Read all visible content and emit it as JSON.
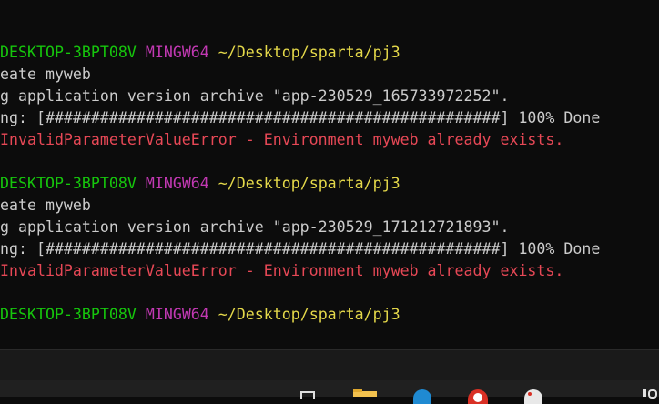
{
  "terminal": {
    "lines": [
      {
        "segments": [
          {
            "text": "DESKTOP-3BPT08V",
            "color": "#16c60c"
          },
          {
            "text": " ",
            "color": "#cccccc"
          },
          {
            "text": "MINGW64",
            "color": "#c239b3"
          },
          {
            "text": " ",
            "color": "#cccccc"
          },
          {
            "text": "~/Desktop/sparta/pj3",
            "color": "#e5d94a"
          }
        ]
      },
      {
        "segments": [
          {
            "text": "eate myweb",
            "color": "#cccccc"
          }
        ]
      },
      {
        "segments": [
          {
            "text": "g application version archive \"app-230529_165733972252\".",
            "color": "#cccccc"
          }
        ]
      },
      {
        "segments": [
          {
            "text": "ng: [##################################################] 100% Done",
            "color": "#cccccc"
          }
        ]
      },
      {
        "segments": [
          {
            "text": "InvalidParameterValueError - Environment myweb already exists.",
            "color": "#e74856"
          }
        ]
      },
      {
        "segments": [
          {
            "text": "",
            "color": "#cccccc"
          }
        ]
      },
      {
        "segments": [
          {
            "text": "DESKTOP-3BPT08V",
            "color": "#16c60c"
          },
          {
            "text": " ",
            "color": "#cccccc"
          },
          {
            "text": "MINGW64",
            "color": "#c239b3"
          },
          {
            "text": " ",
            "color": "#cccccc"
          },
          {
            "text": "~/Desktop/sparta/pj3",
            "color": "#e5d94a"
          }
        ]
      },
      {
        "segments": [
          {
            "text": "eate myweb",
            "color": "#cccccc"
          }
        ]
      },
      {
        "segments": [
          {
            "text": "g application version archive \"app-230529_171212721893\".",
            "color": "#cccccc"
          }
        ]
      },
      {
        "segments": [
          {
            "text": "ng: [##################################################] 100% Done",
            "color": "#cccccc"
          }
        ]
      },
      {
        "segments": [
          {
            "text": "InvalidParameterValueError - Environment myweb already exists.",
            "color": "#e74856"
          }
        ]
      },
      {
        "segments": [
          {
            "text": "",
            "color": "#cccccc"
          }
        ]
      },
      {
        "segments": [
          {
            "text": "DESKTOP-3BPT08V",
            "color": "#16c60c"
          },
          {
            "text": " ",
            "color": "#cccccc"
          },
          {
            "text": "MINGW64",
            "color": "#c239b3"
          },
          {
            "text": " ",
            "color": "#cccccc"
          },
          {
            "text": "~/Desktop/sparta/pj3",
            "color": "#e5d94a"
          }
        ]
      }
    ]
  },
  "taskbar": {
    "icons": [
      "window-icon",
      "folder-icon",
      "edge-icon",
      "chrome-icon",
      "paint-icon",
      "pen-icon"
    ]
  },
  "colors": {
    "background": "#0c0c0c",
    "hostname": "#16c60c",
    "mingw": "#c239b3",
    "path": "#e5d94a",
    "error": "#e74856",
    "text": "#cccccc"
  }
}
